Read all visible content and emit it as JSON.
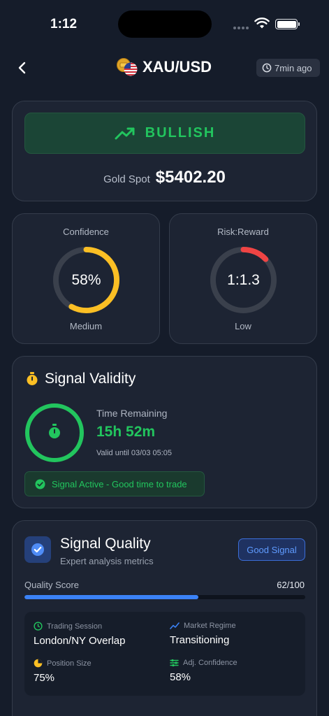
{
  "status_bar": {
    "time": "1:12"
  },
  "header": {
    "title": "XAU/USD",
    "updated": "7min ago"
  },
  "signal": {
    "direction": "BULLISH",
    "spot_label": "Gold Spot",
    "spot_value": "$5402.20"
  },
  "confidence": {
    "label": "Confidence",
    "value": "58%",
    "percent": 58,
    "level": "Medium",
    "color": "#fbbf24"
  },
  "risk_reward": {
    "label": "Risk:Reward",
    "value": "1:1.3",
    "fraction": 0.13,
    "level": "Low",
    "color": "#ef4444"
  },
  "validity": {
    "title": "Signal Validity",
    "remaining_label": "Time Remaining",
    "remaining_value": "15h 52m",
    "valid_until": "Valid until 03/03 05:05",
    "status": "Signal Active - Good time to trade"
  },
  "quality": {
    "title": "Signal Quality",
    "subtitle": "Expert analysis metrics",
    "badge": "Good Signal",
    "score_label": "Quality Score",
    "score_value": "62/100",
    "score_percent": 62,
    "details": [
      {
        "label": "Trading Session",
        "value": "London/NY Overlap",
        "icon": "clock-icon"
      },
      {
        "label": "Market Regime",
        "value": "Transitioning",
        "icon": "trend-icon"
      },
      {
        "label": "Position Size",
        "value": "75%",
        "icon": "pie-icon"
      },
      {
        "label": "Adj. Confidence",
        "value": "58%",
        "icon": "sliders-icon"
      }
    ]
  },
  "colors": {
    "accent_green": "#22c55e",
    "accent_blue": "#3b82f6",
    "background": "#151c2a",
    "card": "#1d2433"
  }
}
